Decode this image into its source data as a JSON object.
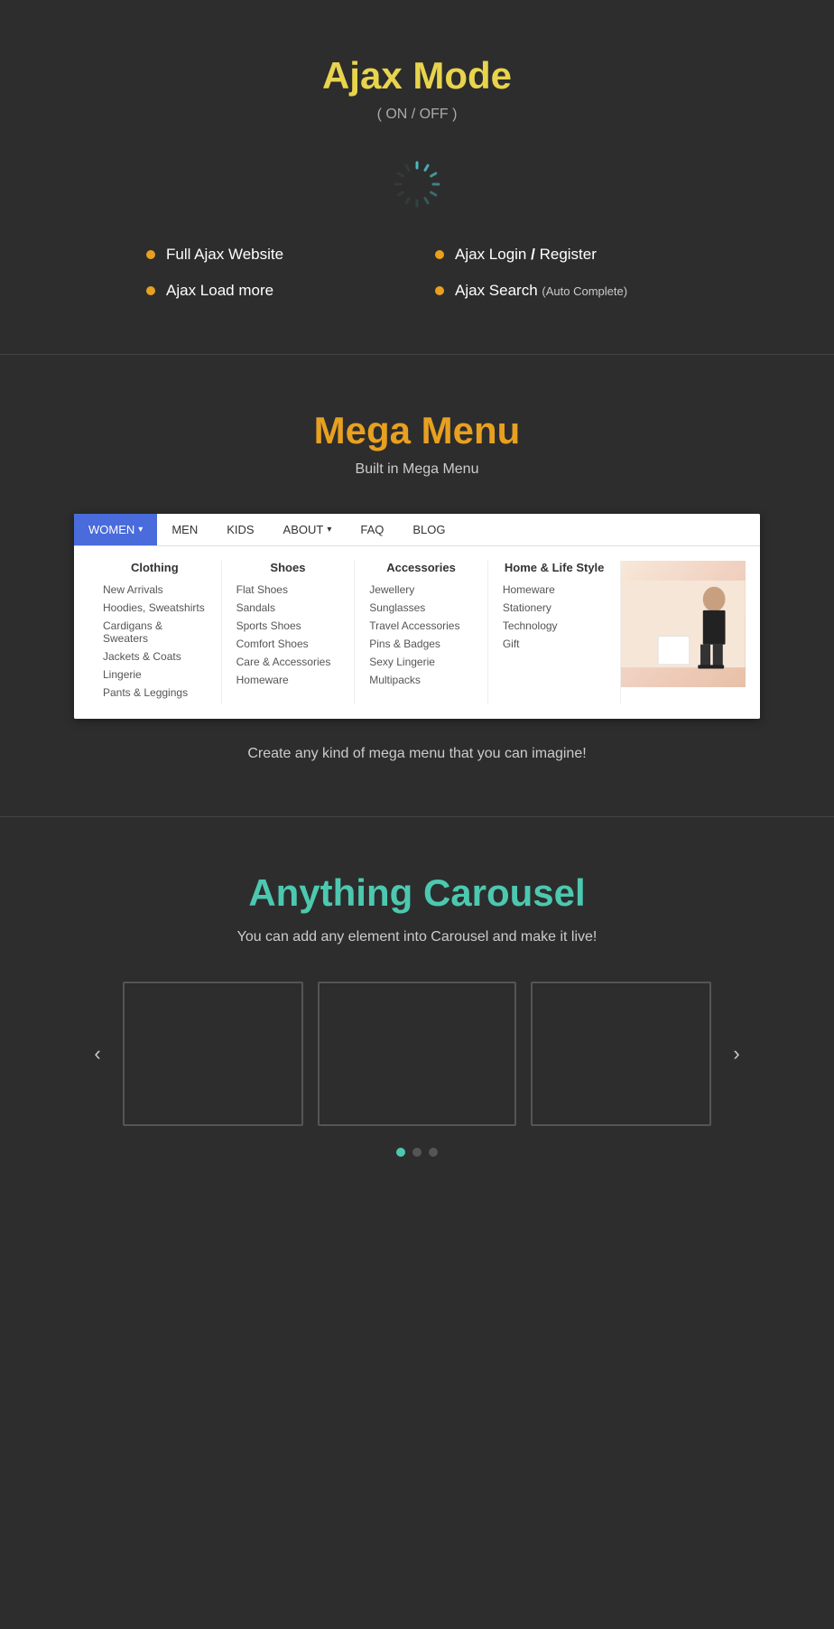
{
  "ajax_section": {
    "title": "Ajax Mode",
    "subtitle": "( ON / OFF )",
    "features": [
      {
        "id": "full-ajax",
        "label": "Full Ajax Website",
        "small": ""
      },
      {
        "id": "ajax-login",
        "label": "Ajax Login ",
        "slash": "/",
        "after": " Register",
        "small": ""
      },
      {
        "id": "ajax-load",
        "label": "Ajax Load more",
        "small": ""
      },
      {
        "id": "ajax-search",
        "label": "Ajax Search",
        "small": " (Auto Complete)"
      }
    ]
  },
  "mega_section": {
    "title": "Mega Menu",
    "subtitle": "Built in Mega Menu",
    "menu": {
      "items": [
        {
          "label": "WOMEN",
          "active": true,
          "has_arrow": true
        },
        {
          "label": "MEN",
          "active": false,
          "has_arrow": false
        },
        {
          "label": "KIDS",
          "active": false,
          "has_arrow": false
        },
        {
          "label": "ABOUT",
          "active": false,
          "has_arrow": true
        },
        {
          "label": "FAQ",
          "active": false,
          "has_arrow": false
        },
        {
          "label": "BLOG",
          "active": false,
          "has_arrow": false
        }
      ],
      "columns": [
        {
          "header": "Clothing",
          "items": [
            "New Arrivals",
            "Hoodies, Sweatshirts",
            "Cardigans & Sweaters",
            "Jackets & Coats",
            "Lingerie",
            "Pants & Leggings"
          ]
        },
        {
          "header": "Shoes",
          "items": [
            "Flat Shoes",
            "Sandals",
            "Sports Shoes",
            "Comfort Shoes",
            "Care & Accessories",
            "Homeware"
          ]
        },
        {
          "header": "Accessories",
          "items": [
            "Jewellery",
            "Sunglasses",
            "Travel Accessories",
            "Pins & Badges",
            "Sexy Lingerie",
            "Multipacks"
          ]
        },
        {
          "header": "Home & Life Style",
          "items": [
            "Homeware",
            "Stationery",
            "Technology",
            "Gift"
          ]
        }
      ]
    },
    "description": "Create any kind of mega menu that you can imagine!"
  },
  "carousel_section": {
    "title": "Anything Carousel",
    "subtitle": "You can add any element into Carousel and make it live!",
    "dots": [
      {
        "active": true
      },
      {
        "active": false
      },
      {
        "active": false
      }
    ],
    "prev_label": "‹",
    "next_label": "›"
  }
}
